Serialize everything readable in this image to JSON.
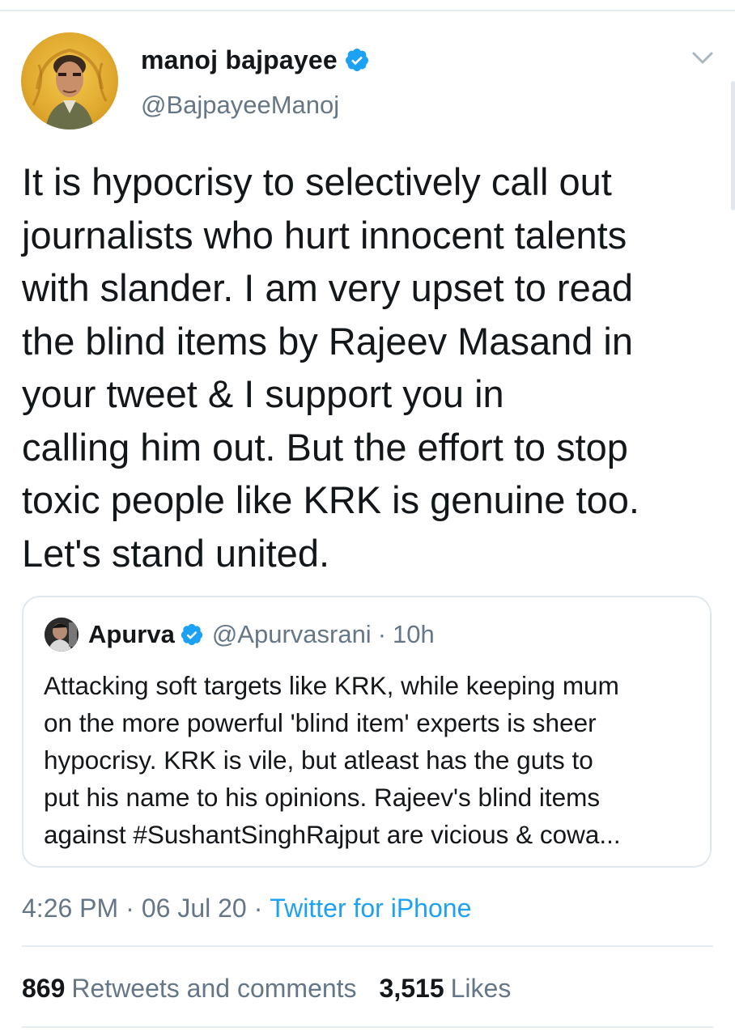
{
  "author": {
    "display_name": "manoj bajpayee",
    "handle": "@BajpayeeManoj",
    "verified": true,
    "avatar_icon": "profile-photo"
  },
  "tweet": {
    "text_lines": [
      "It is hypocrisy to selectively call out",
      "journalists who hurt innocent talents",
      "with slander. I am very upset to read",
      "the blind items by Rajeev Masand in",
      "your tweet & I support you in",
      "calling him out. But the effort to stop",
      "toxic people like KRK is genuine too.",
      "Let's stand united."
    ]
  },
  "quoted_tweet": {
    "display_name": "Apurva",
    "handle": "@Apurvasrani",
    "separator": "·",
    "time": "10h",
    "verified": true,
    "text_lines": [
      "Attacking soft targets like KRK, while keeping mum",
      "on the more powerful 'blind item' experts is sheer",
      "hypocrisy. KRK is vile, but atleast has the guts to",
      "put his name to his opinions. Rajeev's blind items",
      "against #SushantSinghRajput are  vicious & cowa..."
    ]
  },
  "meta": {
    "time": "4:26 PM",
    "separator": "·",
    "date": "06 Jul 20",
    "source": "Twitter for iPhone"
  },
  "stats": {
    "retweets_count": "869",
    "retweets_label": "Retweets and comments",
    "likes_count": "3,515",
    "likes_label": "Likes"
  },
  "colors": {
    "text_primary": "#14171a",
    "text_secondary": "#657786",
    "link_blue": "#1da1f2",
    "divider": "#e6ecf0"
  }
}
